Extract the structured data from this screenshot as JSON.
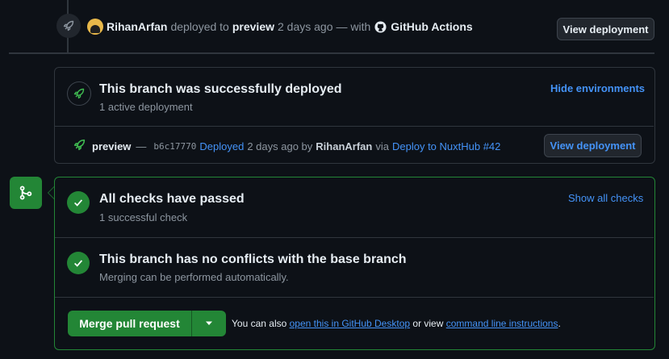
{
  "deploy_event": {
    "user": "RihanArfan",
    "deployed_to": "deployed to",
    "env": "preview",
    "time": "2 days ago",
    "with": "— with",
    "actor": "GitHub Actions",
    "button_label": "View deployment"
  },
  "deploy_box": {
    "title": "This branch was successfully deployed",
    "subtitle": "1 active deployment",
    "toggle_link": "Hide environments",
    "row": {
      "env": "preview",
      "dash": "—",
      "sha": "b6c17770",
      "status": "Deployed",
      "time": "2 days ago by",
      "user": "RihanArfan",
      "via": "via",
      "workflow": "Deploy to NuxtHub #42",
      "button_label": "View deployment"
    }
  },
  "merge_box": {
    "checks_title": "All checks have passed",
    "checks_subtitle": "1 successful check",
    "checks_link": "Show all checks",
    "conflicts_title": "This branch has no conflicts with the base branch",
    "conflicts_subtitle": "Merging can be performed automatically.",
    "merge_button": "Merge pull request",
    "footer_prefix": "You can also",
    "footer_link1": "open this in GitHub Desktop",
    "footer_middle": "or view",
    "footer_link2": "command line instructions",
    "footer_end": "."
  },
  "colors": {
    "success": "#238636",
    "link": "#4493f8",
    "background": "#0d1117"
  },
  "icons": [
    "rocket-icon",
    "github-icon",
    "git-merge-icon",
    "check-icon",
    "triangle-down-icon"
  ]
}
